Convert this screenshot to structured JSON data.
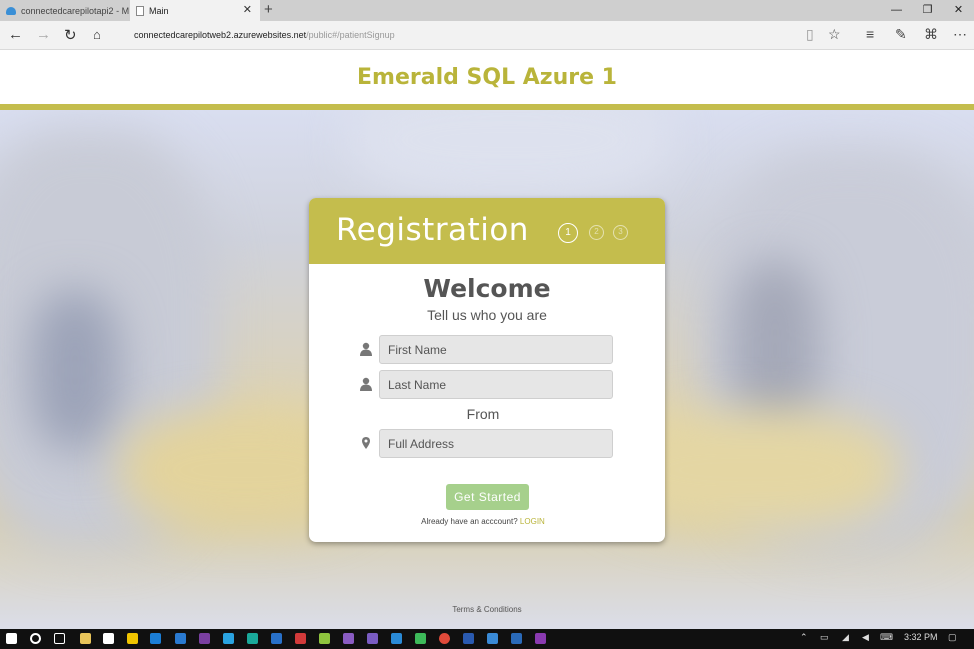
{
  "browser": {
    "tabs": [
      {
        "label": "connectedcarepilotapi2 - M",
        "active": false
      },
      {
        "label": "Main",
        "active": true
      }
    ],
    "new_tab_glyph": "+",
    "url_main": "connectedcarepilotweb2.azurewebsites.net",
    "url_path": "/public#/patientSignup",
    "window_controls": [
      "—",
      "❐",
      "✕"
    ]
  },
  "header": {
    "title": "Emerald SQL Azure 1"
  },
  "card": {
    "title": "Registration",
    "steps": [
      "1",
      "2",
      "3"
    ],
    "welcome": "Welcome",
    "tagline": "Tell us who you are",
    "first_name_placeholder": "First Name",
    "last_name_placeholder": "Last Name",
    "from_label": "From",
    "address_placeholder": "Full Address",
    "submit_label": "Get Started",
    "already_text": "Already have an acccount?",
    "login_link": "LOGIN"
  },
  "footer": {
    "terms": "Terms & Conditions"
  },
  "taskbar": {
    "time": "3:32 PM"
  },
  "colors": {
    "accent": "#c4bd4d",
    "title": "#b9b43a",
    "button": "#a6d08c"
  }
}
